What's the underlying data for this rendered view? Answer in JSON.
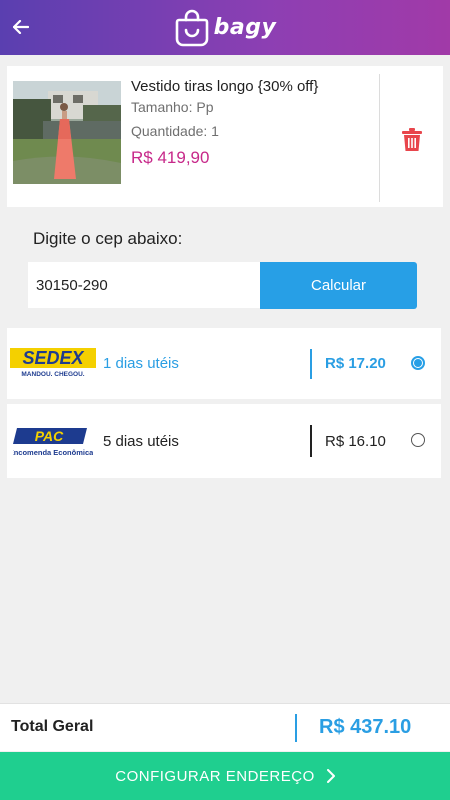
{
  "header": {
    "brand": "bagy",
    "back_icon": "arrow-left-icon"
  },
  "colors": {
    "header_gradient": [
      "#5a3fb0",
      "#a13aa8"
    ],
    "accent_blue": "#279fe6",
    "price_pink": "#c7298a",
    "cta_green": "#1fcf8f",
    "trash_red": "#e8464c"
  },
  "cart_item": {
    "name": "Vestido tiras longo {30% off}",
    "size": "Tamanho: Pp",
    "quantity": "Quantidade: 1",
    "price": "R$ 419,90",
    "delete_icon": "trash-icon"
  },
  "cep": {
    "label": "Digite o cep abaixo:",
    "value": "30150-290",
    "button_label": "Calcular"
  },
  "shipping_options": [
    {
      "carrier": "SEDEX",
      "tagline": "MANDOU. CHEGOU.",
      "days": "1 dias utéis",
      "price": "R$ 17.20",
      "selected": true
    },
    {
      "carrier": "PAC",
      "tagline": "Encomenda Econômica",
      "days": "5 dias utéis",
      "price": "R$ 16.10",
      "selected": false
    }
  ],
  "total": {
    "label": "Total Geral",
    "value": "R$ 437.10"
  },
  "cta": {
    "label": "CONFIGURAR ENDEREÇO",
    "icon": "chevron-right-icon"
  }
}
